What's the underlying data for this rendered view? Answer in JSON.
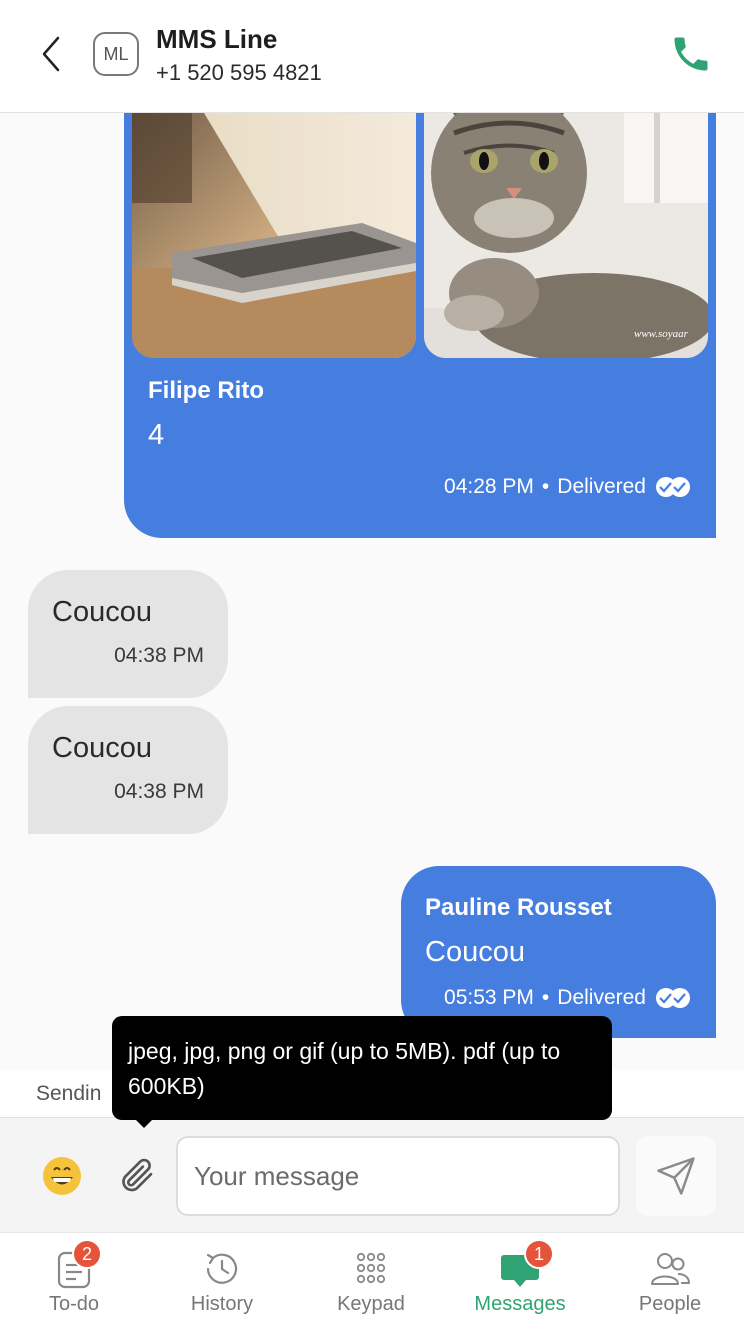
{
  "header": {
    "avatar_initials": "ML",
    "contact_name": "MMS Line",
    "contact_number": "+1 520 595 4821"
  },
  "messages": [
    {
      "direction": "outgoing",
      "sender": "Filipe Rito",
      "text": "4",
      "time": "04:28 PM",
      "status": "Delivered",
      "attachments": [
        "laptop-photo",
        "cat-photo"
      ]
    },
    {
      "direction": "incoming",
      "text": "Coucou",
      "time": "04:38 PM"
    },
    {
      "direction": "incoming",
      "text": "Coucou",
      "time": "04:38 PM"
    },
    {
      "direction": "outgoing",
      "sender": "Pauline Rousset",
      "text": "Coucou",
      "time": "05:53 PM",
      "status": "Delivered"
    }
  ],
  "status_strip": {
    "text": "Sendin"
  },
  "tooltip": {
    "text": "jpeg, jpg, png or gif (up to 5MB). pdf (up to 600KB)"
  },
  "composer": {
    "placeholder": "Your message"
  },
  "separator": " • ",
  "tabs": [
    {
      "label": "To-do",
      "badge": "2",
      "icon": "todo-icon"
    },
    {
      "label": "History",
      "icon": "history-icon"
    },
    {
      "label": "Keypad",
      "icon": "keypad-icon"
    },
    {
      "label": "Messages",
      "badge": "1",
      "icon": "messages-icon",
      "active": true
    },
    {
      "label": "People",
      "icon": "people-icon"
    }
  ],
  "colors": {
    "outgoing_bubble": "#467ee0",
    "incoming_bubble": "#e4e4e4",
    "accent_green": "#2fa374",
    "badge_red": "#e4533a"
  }
}
